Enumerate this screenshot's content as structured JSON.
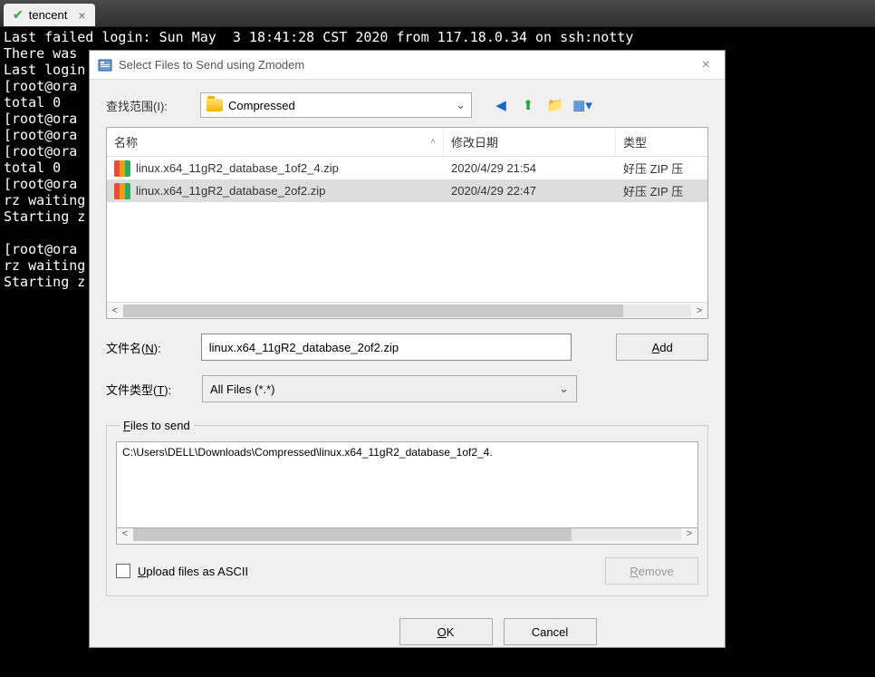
{
  "tab": {
    "title": "tencent"
  },
  "terminal": {
    "lines": "Last failed login: Sun May  3 18:41:28 CST 2020 from 117.18.0.34 on ssh:notty\nThere was \nLast login\n[root@ora\ntotal 0\n[root@ora\n[root@ora\n[root@ora\ntotal 0\n[root@ora\nrz waiting\nStarting z\n\n[root@ora\nrz waiting\nStarting z"
  },
  "dialog": {
    "title": "Select Files to Send using Zmodem",
    "lookin_label": "查找范围(I):",
    "folder": "Compressed",
    "columns": {
      "name": "名称",
      "date": "修改日期",
      "type": "类型"
    },
    "files": [
      {
        "name": "linux.x64_11gR2_database_1of2_4.zip",
        "date": "2020/4/29 21:54",
        "type": "好压 ZIP 压",
        "selected": false
      },
      {
        "name": "linux.x64_11gR2_database_2of2.zip",
        "date": "2020/4/29 22:47",
        "type": "好压 ZIP 压",
        "selected": true
      }
    ],
    "filename_label": "文件名(N):",
    "filename_value": "linux.x64_11gR2_database_2of2.zip",
    "filetype_label": "文件类型(T):",
    "filetype_value": "All Files (*.*)",
    "add_label": "Add",
    "files_to_send_label": "Files to send",
    "files_to_send_path": "C:\\Users\\DELL\\Downloads\\Compressed\\linux.x64_11gR2_database_1of2_4.",
    "ascii_label": "Upload files as ASCII",
    "remove_label": "Remove",
    "ok_label": "OK",
    "cancel_label": "Cancel"
  }
}
